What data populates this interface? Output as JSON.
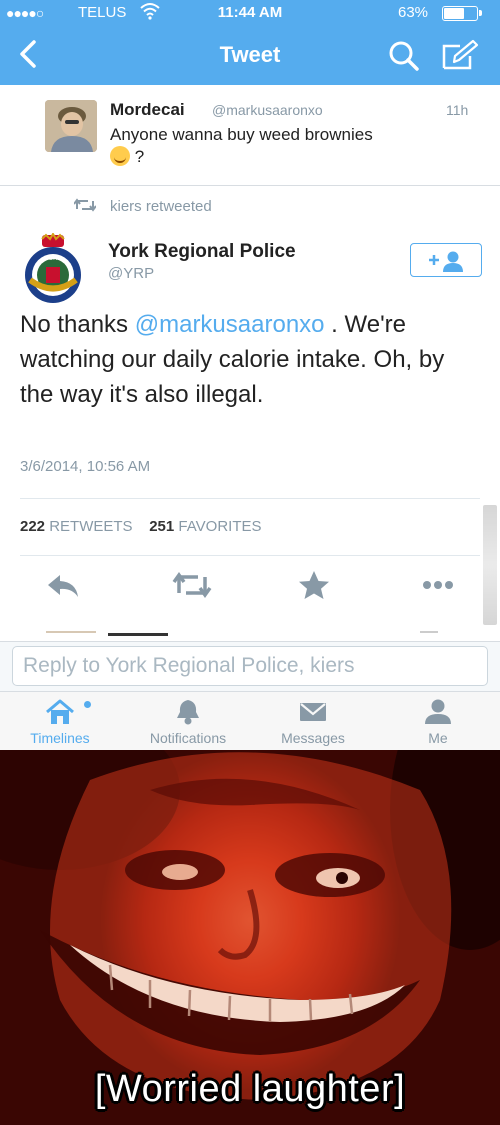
{
  "status_bar": {
    "signal": "●●●●○",
    "carrier": "TELUS",
    "time": "11:44 AM",
    "battery_pct": "63%",
    "battery_level": 0.63
  },
  "nav": {
    "title": "Tweet"
  },
  "parent_tweet": {
    "name": "Mordecai",
    "handle": "@markusaaronxo",
    "time": "11h",
    "text": "Anyone wanna buy weed brownies",
    "text_tail": " ?"
  },
  "retweet_line": {
    "label": "kiers retweeted"
  },
  "main_tweet": {
    "name": "York Regional Police",
    "handle": "@YRP",
    "body_before": "No thanks ",
    "mention": "@markusaaronxo",
    "body_after": " . We're watching our daily calorie intake. Oh, by the way it's also illegal.",
    "date": "3/6/2014, 10:56 AM",
    "retweets_count": "222",
    "retweets_label": "RETWEETS",
    "favorites_count": "251",
    "favorites_label": "FAVORITES"
  },
  "reply": {
    "placeholder": "Reply to York Regional Police, kiers"
  },
  "tabs": [
    {
      "label": "Timelines",
      "icon": "home-icon",
      "active": true
    },
    {
      "label": "Notifications",
      "icon": "bell-icon",
      "active": false
    },
    {
      "label": "Messages",
      "icon": "envelope-icon",
      "active": false
    },
    {
      "label": "Me",
      "icon": "person-icon",
      "active": false
    }
  ],
  "colors": {
    "twitter_blue": "#55acee",
    "muted_text": "#8899a6"
  },
  "meme": {
    "caption": "[Worried laughter]"
  }
}
